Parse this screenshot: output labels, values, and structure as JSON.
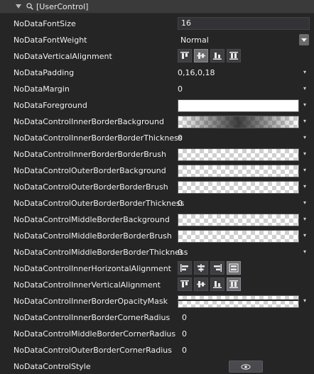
{
  "category": {
    "title": "[UserControl]",
    "expand_icon": "triangle-down-icon",
    "category_icon": "search-icon"
  },
  "properties": [
    {
      "label": "NoDataFontSize",
      "value": "16"
    },
    {
      "label": "NoDataFontWeight",
      "value": "Normal"
    },
    {
      "label": "NoDataVerticalAlignment"
    },
    {
      "label": "NoDataPadding",
      "value": "0,16,0,18"
    },
    {
      "label": "NoDataMargin",
      "value": "0"
    },
    {
      "label": "NoDataForeground"
    },
    {
      "label": "NoDataControlInnerBorderBackground"
    },
    {
      "label": "NoDataControlInnerBorderBorderThickness",
      "value": "0"
    },
    {
      "label": "NoDataControlInnerBorderBorderBrush"
    },
    {
      "label": "NoDataControlOuterBorderBackground"
    },
    {
      "label": "NoDataControlOuterBorderBorderBrush"
    },
    {
      "label": "NoDataControlOuterBorderBorderThickness",
      "value": "0"
    },
    {
      "label": "NoDataControlMiddleBorderBackground"
    },
    {
      "label": "NoDataControlMiddleBorderBorderBrush"
    },
    {
      "label": "NoDataControlMiddleBorderBorderThickness",
      "value": "0"
    },
    {
      "label": "NoDataControlInnerHorizontalAlignment"
    },
    {
      "label": "NoDataControlInnerVerticalAlignment"
    },
    {
      "label": "NoDataControlInnerBorderOpacityMask"
    },
    {
      "label": "NoDataControlInnerBorderCornerRadius",
      "value": "0"
    },
    {
      "label": "NoDataControlMiddleBorderCornerRadius",
      "value": "0"
    },
    {
      "label": "NoDataControlOuterBorderCornerRadius",
      "value": "0"
    },
    {
      "label": "NoDataControlStyle"
    }
  ],
  "vertical_alignment_buttons": [
    "align-top-icon",
    "align-center-icon",
    "align-bottom-icon",
    "align-stretch-icon"
  ],
  "vertical_alignment_selected": "align-center-icon",
  "horizontal_alignment_buttons": [
    "align-left-icon",
    "align-center-icon",
    "align-right-icon",
    "align-stretch-icon"
  ],
  "horizontal_alignment_selected": "align-stretch-icon",
  "inner_vertical_alignment_buttons": [
    "align-top-icon",
    "align-center-icon",
    "align-bottom-icon",
    "align-stretch-icon"
  ],
  "inner_vertical_alignment_selected": "align-stretch-icon",
  "style_button_icon": "eye-icon",
  "colors": {
    "background": "#252526",
    "header": "#3a3a3a",
    "foreground_brush": "#ffffff",
    "selected_button": "#6c6c70"
  }
}
